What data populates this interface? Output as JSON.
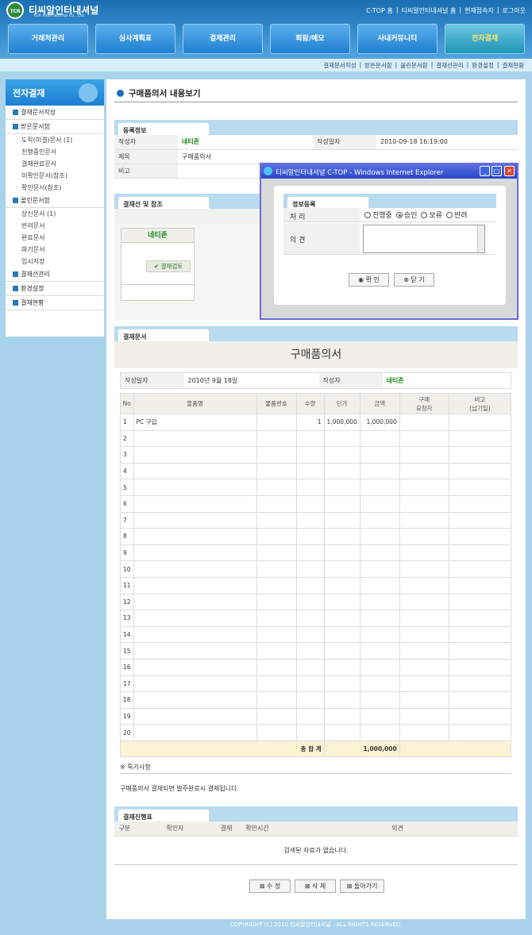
{
  "header": {
    "logo": "TCR",
    "brand": "티씨알인터내셔널",
    "brand_en": "TCR International Co., Ltd",
    "links": [
      "C-TOP 홈",
      "|",
      "티씨알인터내셔널 홈",
      "|",
      "현재접속자",
      "|",
      "로그아웃"
    ]
  },
  "nav": [
    "거래처관리",
    "심사계획표",
    "결제관리",
    "회람/메모",
    "사내커뮤니티",
    "전자결재"
  ],
  "subnav": [
    "결재문서작성",
    "|",
    "받은문서함",
    "|",
    "올린문서함",
    "|",
    "결재선관리",
    "|",
    "환경설정",
    "|",
    "결재현황"
  ],
  "sidebar": {
    "title": "전자결재",
    "groups": [
      {
        "label": "결재문서작성",
        "subs": []
      },
      {
        "label": "받은문서함",
        "subs": [
          "도착(미결)문서 (1)",
          "진행중인문서",
          "결재완료문서",
          "미확인문서(참조)",
          "확인문서(참조)"
        ]
      },
      {
        "label": "올린문서함",
        "subs": [
          "상신문서 (1)",
          "반려문서",
          "완료문서",
          "파기문서",
          "임시저장"
        ]
      },
      {
        "label": "결재선관리",
        "subs": []
      },
      {
        "label": "환경설정",
        "subs": []
      },
      {
        "label": "결재현황",
        "subs": []
      }
    ]
  },
  "page": {
    "title": "구매품의서 내용보기"
  },
  "reg": {
    "tab": "등록정보",
    "writer_label": "작성자",
    "writer": "네티존",
    "date_label": "작성일자",
    "date": "2010-09-18 16:19:00",
    "subject_label": "제목",
    "subject": "구매품의서",
    "note_label": "비고"
  },
  "approval": {
    "tab": "결재선 및 참조",
    "name": "네티존",
    "status": "결재검토"
  },
  "doc": {
    "tab": "결재문서",
    "title": "구매품의서",
    "date_label": "작성일자",
    "date": "2010년 9월 18일",
    "writer_label": "작성자",
    "writer": "네티존",
    "headers": [
      "No",
      "물품명",
      "물품번호",
      "수량",
      "단가",
      "금액",
      "구매\n요청자",
      "비고\n(납기일)"
    ],
    "row1": {
      "no": "1",
      "name": "PC 구입",
      "qty": "1",
      "price": "1,000,000",
      "amount": "1,000,000"
    },
    "total_label": "총 합 계",
    "total": "1,000,000",
    "special_label": "※ 특기사항",
    "special": "구매품의서 결재되면 발주완료시 결제됩니다."
  },
  "progress": {
    "tab": "결재진행표",
    "headers": [
      "구분",
      "확인자",
      "결재",
      "확인시간",
      "의견"
    ],
    "empty": "검색된 자료가 없습니다."
  },
  "buttons": [
    "수 정",
    "삭 제",
    "돌아가기"
  ],
  "footer": "COPYRIGHT (C) 2010 티씨알인터내셔널 . ALL RIGHTS RESERVED.",
  "dialog": {
    "title": "티씨알인터내셔널 C-TOP - Windows Internet Explorer",
    "tab": "정보등록",
    "proc_label": "처 리",
    "options": [
      "진행중",
      "승인",
      "보류",
      "반려"
    ],
    "opinion_label": "의 견",
    "ok": "확 인",
    "close": "닫 기"
  }
}
